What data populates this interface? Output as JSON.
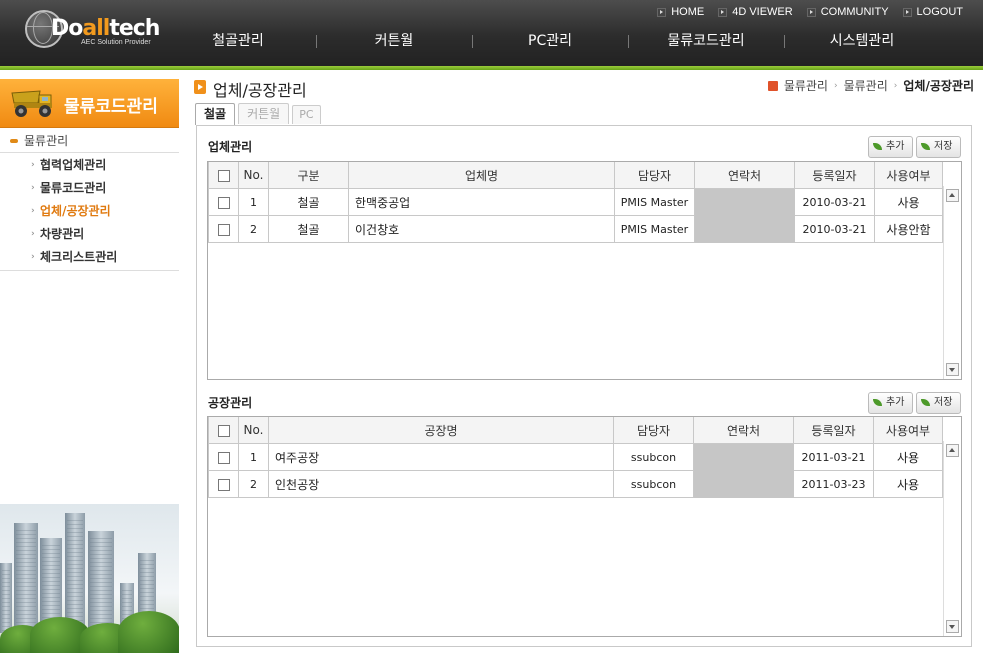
{
  "header": {
    "logo": {
      "name_prefix": "Do",
      "name_accent": "all",
      "name_suffix": "tech",
      "subtitle": "AEC Solution Provider"
    },
    "util_nav": [
      "HOME",
      "4D VIEWER",
      "COMMUNITY",
      "LOGOUT"
    ],
    "main_nav": [
      "철골관리",
      "커튼월",
      "PC관리",
      "물류코드관리",
      "시스템관리"
    ]
  },
  "sidebar": {
    "title": "물류코드관리",
    "group": "물류관리",
    "items": [
      {
        "label": "협력업체관리",
        "active": false
      },
      {
        "label": "물류코드관리",
        "active": false
      },
      {
        "label": "업체/공장관리",
        "active": true
      },
      {
        "label": "차량관리",
        "active": false
      },
      {
        "label": "체크리스트관리",
        "active": false
      }
    ]
  },
  "page": {
    "title": "업체/공장관리",
    "breadcrumb": [
      "물류관리",
      "물류관리",
      "업체/공장관리"
    ],
    "tabs": [
      "철골",
      "커튼월",
      "PC"
    ]
  },
  "company_section": {
    "title": "업체관리",
    "add_label": "추가",
    "save_label": "저장",
    "columns": [
      "No.",
      "구분",
      "업체명",
      "담당자",
      "연락처",
      "등록일자",
      "사용여부"
    ],
    "rows": [
      {
        "no": "1",
        "type": "철골",
        "name": "한맥중공업",
        "manager": "PMIS Master",
        "contact": "",
        "date": "2010-03-21",
        "use": "사용"
      },
      {
        "no": "2",
        "type": "철골",
        "name": "이건창호",
        "manager": "PMIS Master",
        "contact": "",
        "date": "2010-03-21",
        "use": "사용안함"
      }
    ]
  },
  "factory_section": {
    "title": "공장관리",
    "add_label": "추가",
    "save_label": "저장",
    "columns": [
      "No.",
      "공장명",
      "담당자",
      "연락처",
      "등록일자",
      "사용여부"
    ],
    "rows": [
      {
        "no": "1",
        "name": "여주공장",
        "manager": "ssubcon",
        "contact": "",
        "date": "2011-03-21",
        "use": "사용"
      },
      {
        "no": "2",
        "name": "인천공장",
        "manager": "ssubcon",
        "contact": "",
        "date": "2011-03-23",
        "use": "사용"
      }
    ]
  }
}
